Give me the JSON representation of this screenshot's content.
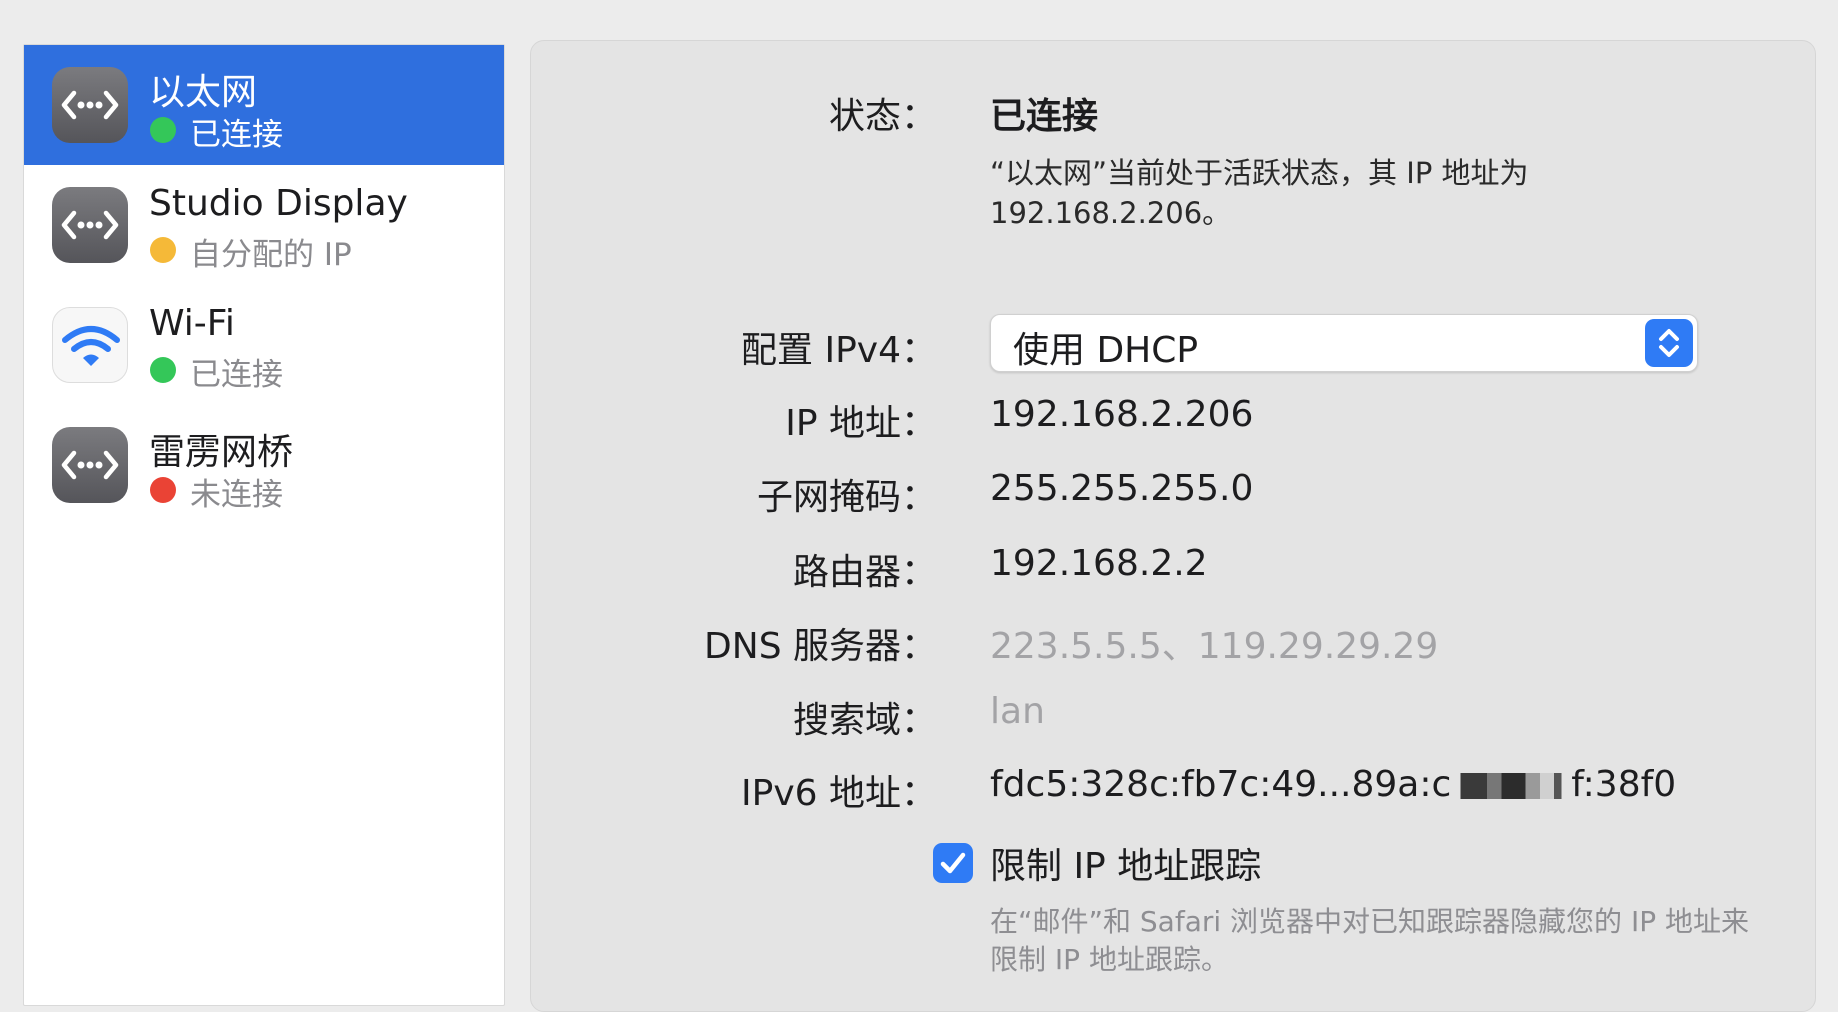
{
  "colors": {
    "accent": "#2f6fde",
    "status_connected": "#34c759",
    "status_self_assigned": "#f5b938",
    "status_disconnected": "#ea4335",
    "checkbox": "#2f7bf5"
  },
  "sidebar": {
    "services": [
      {
        "name": "以太网",
        "status": "已连接",
        "icon": "ethernet-icon",
        "status_color": "#34c759",
        "selected": true
      },
      {
        "name": "Studio Display",
        "status": "自分配的 IP",
        "icon": "ethernet-icon",
        "status_color": "#f5b938",
        "selected": false
      },
      {
        "name": "Wi-Fi",
        "status": "已连接",
        "icon": "wifi-icon",
        "status_color": "#34c759",
        "selected": false
      },
      {
        "name": "雷雳网桥",
        "status": "未连接",
        "icon": "ethernet-icon",
        "status_color": "#ea4335",
        "selected": false
      }
    ]
  },
  "detail": {
    "status_label": "状态：",
    "status_value": "已连接",
    "status_description": "“以太网”当前处于活跃状态，其 IP 地址为 192.168.2.206。",
    "config_ipv4_label": "配置 IPv4：",
    "config_ipv4_value": "使用 DHCP",
    "ip_label": "IP 地址：",
    "ip_value": "192.168.2.206",
    "subnet_label": "子网掩码：",
    "subnet_value": "255.255.255.0",
    "router_label": "路由器：",
    "router_value": "192.168.2.2",
    "dns_label": "DNS 服务器：",
    "dns_value": "223.5.5.5、119.29.29.29",
    "search_domain_label": "搜索域：",
    "search_domain_value": "lan",
    "ipv6_label": "IPv6 地址：",
    "ipv6_value_prefix": "fdc5:328c:fb7c:49...89a:c",
    "ipv6_value_suffix": "f:38f0",
    "limit_tracking_label": "限制 IP 地址跟踪",
    "limit_tracking_checked": true,
    "limit_tracking_description": "在“邮件”和 Safari 浏览器中对已知跟踪器隐藏您的 IP 地址来限制 IP 地址跟踪。"
  }
}
